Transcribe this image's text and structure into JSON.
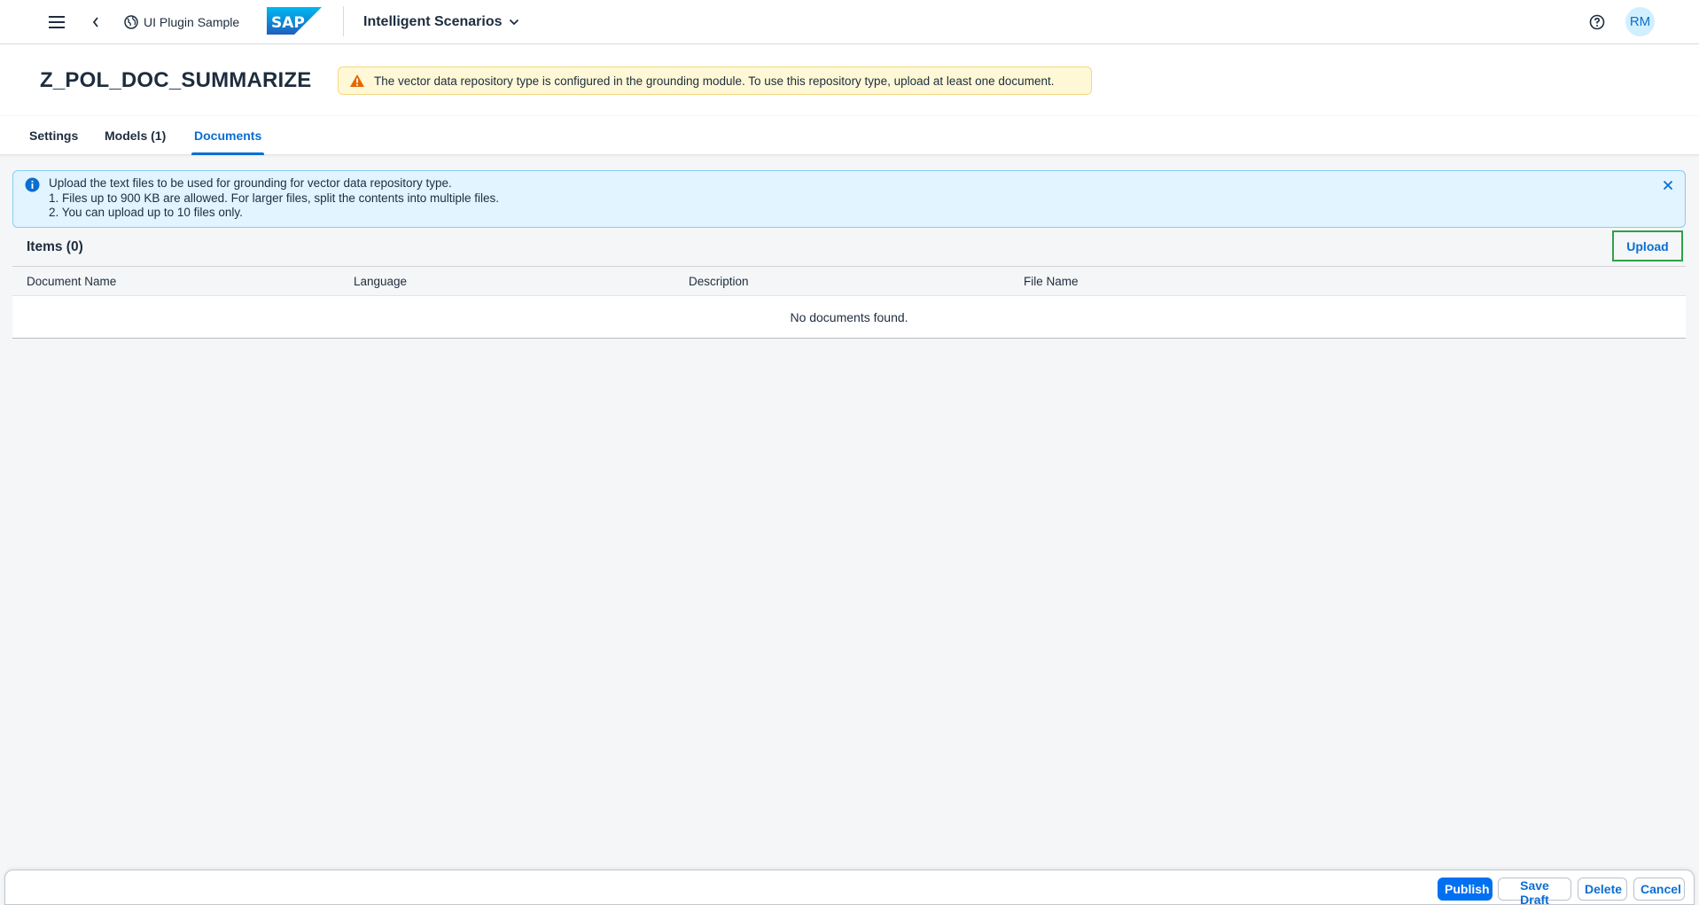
{
  "shell": {
    "menu_icon": "hamburger-icon",
    "back_icon": "chevron-left-icon",
    "plugin_icon": "globe-icon",
    "plugin_label": "UI Plugin Sample",
    "logo_text": "SAP",
    "app_title": "Intelligent Scenarios",
    "help_icon": "help-icon",
    "avatar_initials": "RM"
  },
  "header": {
    "title": "Z_POL_DOC_SUMMARIZE",
    "warning_text": "The vector data repository type is configured in the grounding module. To use this repository type, upload at least one document."
  },
  "tabs": [
    {
      "label": "Settings",
      "active": false
    },
    {
      "label": "Models (1)",
      "active": false
    },
    {
      "label": "Documents",
      "active": true
    }
  ],
  "info": {
    "line1": "Upload the text files to be used for grounding for vector data repository type.",
    "line2": "1. Files up to 900 KB are allowed. For larger files, split the contents into multiple files.",
    "line3": "2. You can upload up to 10 files only."
  },
  "table": {
    "count_label": "Items (0)",
    "upload_label": "Upload",
    "columns": [
      "Document Name",
      "Language",
      "Description",
      "File Name"
    ],
    "empty_text": "No documents found."
  },
  "footer": {
    "publish": "Publish",
    "save_draft": "Save Draft",
    "delete": "Delete",
    "cancel": "Cancel"
  },
  "colors": {
    "accent": "#0a6ed1",
    "primary_button": "#0070f2",
    "warning_bg": "#fff8d6",
    "info_bg": "#e1f4ff",
    "highlight_border": "#2ea24a"
  }
}
